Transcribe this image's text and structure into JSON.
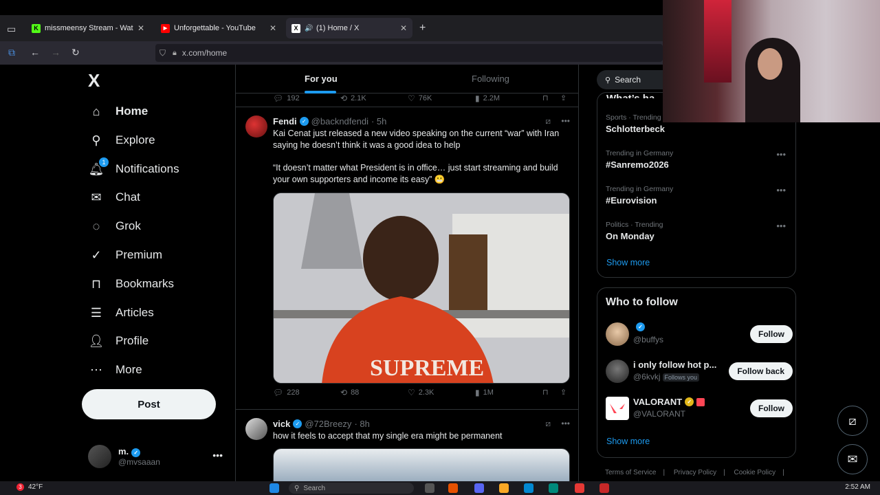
{
  "browser": {
    "tabs": [
      {
        "title": "missmeensy Stream - Watch Liv",
        "favicon": "K",
        "color": "#53fc18"
      },
      {
        "title": "Unforgettable - YouTube",
        "favicon": "▶",
        "color": "#ff0000"
      },
      {
        "title": "(1) Home / X",
        "favicon": "X",
        "color": "#ffffff",
        "audio": "🔊"
      }
    ],
    "new_tab": "+",
    "url": "x.com/home"
  },
  "nav": {
    "logo": "X",
    "items": [
      {
        "label": "Home",
        "icon": "home-icon"
      },
      {
        "label": "Explore",
        "icon": "search-icon"
      },
      {
        "label": "Notifications",
        "icon": "bell-icon",
        "badge": "1"
      },
      {
        "label": "Chat",
        "icon": "mail-icon"
      },
      {
        "label": "Grok",
        "icon": "grok-icon"
      },
      {
        "label": "Premium",
        "icon": "premium-icon"
      },
      {
        "label": "Bookmarks",
        "icon": "bookmark-icon"
      },
      {
        "label": "Articles",
        "icon": "articles-icon"
      },
      {
        "label": "Profile",
        "icon": "profile-icon"
      },
      {
        "label": "More",
        "icon": "more-circle-icon"
      }
    ],
    "post_label": "Post",
    "account": {
      "name": "m.",
      "handle": "@mvsaaan"
    }
  },
  "feed": {
    "tabs": [
      "For you",
      "Following"
    ],
    "prev_actions": {
      "replies": "192",
      "reposts": "2.1K",
      "likes": "76K",
      "views": "2.2M"
    },
    "tweets": [
      {
        "name": "Fendi",
        "handle": "@backndfendi",
        "time": "· 5h",
        "text1": "Kai Cenat just released a new video speaking on the current “war” with Iran saying he doesn’t think it was a good idea to help",
        "text2": "“It doesn’t matter what President is in office… just start streaming and build your own supporters and income its easy” 😬",
        "replies": "228",
        "reposts": "88",
        "likes": "2.3K",
        "views": "1M",
        "shirt": "SUPREME"
      },
      {
        "name": "vick",
        "handle": "@72Breezy",
        "time": "· 8h",
        "text1": "how it feels to accept that my single era might be permanent"
      }
    ]
  },
  "sidebar": {
    "search_placeholder": "Search",
    "trends_heading": "What’s ha",
    "trends": [
      {
        "meta": "Sports · Trending",
        "title": "Schlotterbeck"
      },
      {
        "meta": "Trending in Germany",
        "title": "#Sanremo2026"
      },
      {
        "meta": "Trending in Germany",
        "title": "#Eurovision"
      },
      {
        "meta": "Politics · Trending",
        "title": "On Monday"
      }
    ],
    "show_more": "Show more",
    "who_to_follow": {
      "title": "Who to follow",
      "people": [
        {
          "name": "",
          "handle": "@buffys",
          "button": "Follow",
          "follows_you": ""
        },
        {
          "name": "i only follow hot p...",
          "handle": "@6kvkj",
          "button": "Follow back",
          "follows_you": "Follows you"
        },
        {
          "name": "VALORANT",
          "handle": "@VALORANT",
          "button": "Follow",
          "follows_you": ""
        }
      ],
      "show_more": "Show more"
    },
    "footer": [
      "Terms of Service",
      "Privacy Policy",
      "Cookie Policy"
    ]
  },
  "taskbar": {
    "weather": "42°F",
    "weather_badge": "3",
    "time": "2:52 AM",
    "search": "Search"
  },
  "colors": {
    "accent": "#1d9bf0",
    "background": "#000000",
    "border": "#2f3336"
  }
}
